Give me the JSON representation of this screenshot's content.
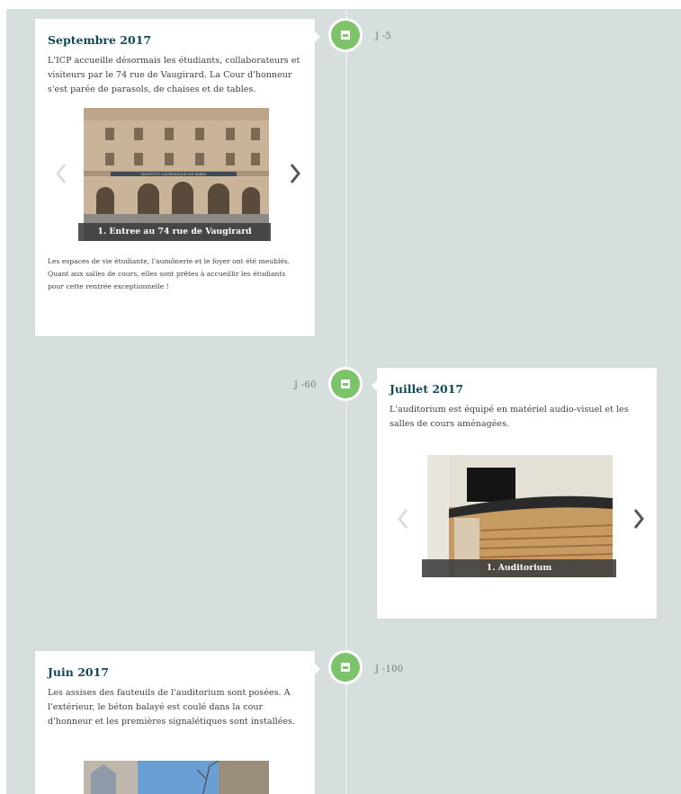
{
  "entries": [
    {
      "date": "Septembre 2017",
      "countdown": "J -5",
      "text": "L'ICP accueille désormais les étudiants, collaborateurs et visiteurs par le 74 rue de Vaugirard. La Cour d'honneur s'est parée de parasols, de chaises et de tables.",
      "slide_caption": "1. Entree au 74 rue de Vaugirard",
      "footer_text": "Les espaces de vie étudiante, l'aumônerie et le foyer ont été meublés. Quant aux salles de cours, elles sont prêtes à accueillir les étudiants pour cette rentrée exceptionnelle !",
      "photo_sign": "INSTITUT CATHOLIQUE DE PARIS"
    },
    {
      "date": "Juillet 2017",
      "countdown": "J -60",
      "text": "L'auditorium est équipé en matériel audio-visuel et les salles de cours aménagées.",
      "slide_caption": "1. Auditorium"
    },
    {
      "date": "Juin 2017",
      "countdown": "J -100",
      "text": "Les assises des fauteuils de l'auditorium sont posées. A l'extérieur, le béton balayé est coulé dans la cour d'honneur et les premières signalétiques sont installées."
    }
  ],
  "icons": {
    "node": "photo-icon",
    "prev": "chevron-left-icon",
    "next": "chevron-right-icon"
  },
  "colors": {
    "background": "#d6dfde",
    "node": "#7cc36a",
    "heading": "#0f4a55"
  }
}
